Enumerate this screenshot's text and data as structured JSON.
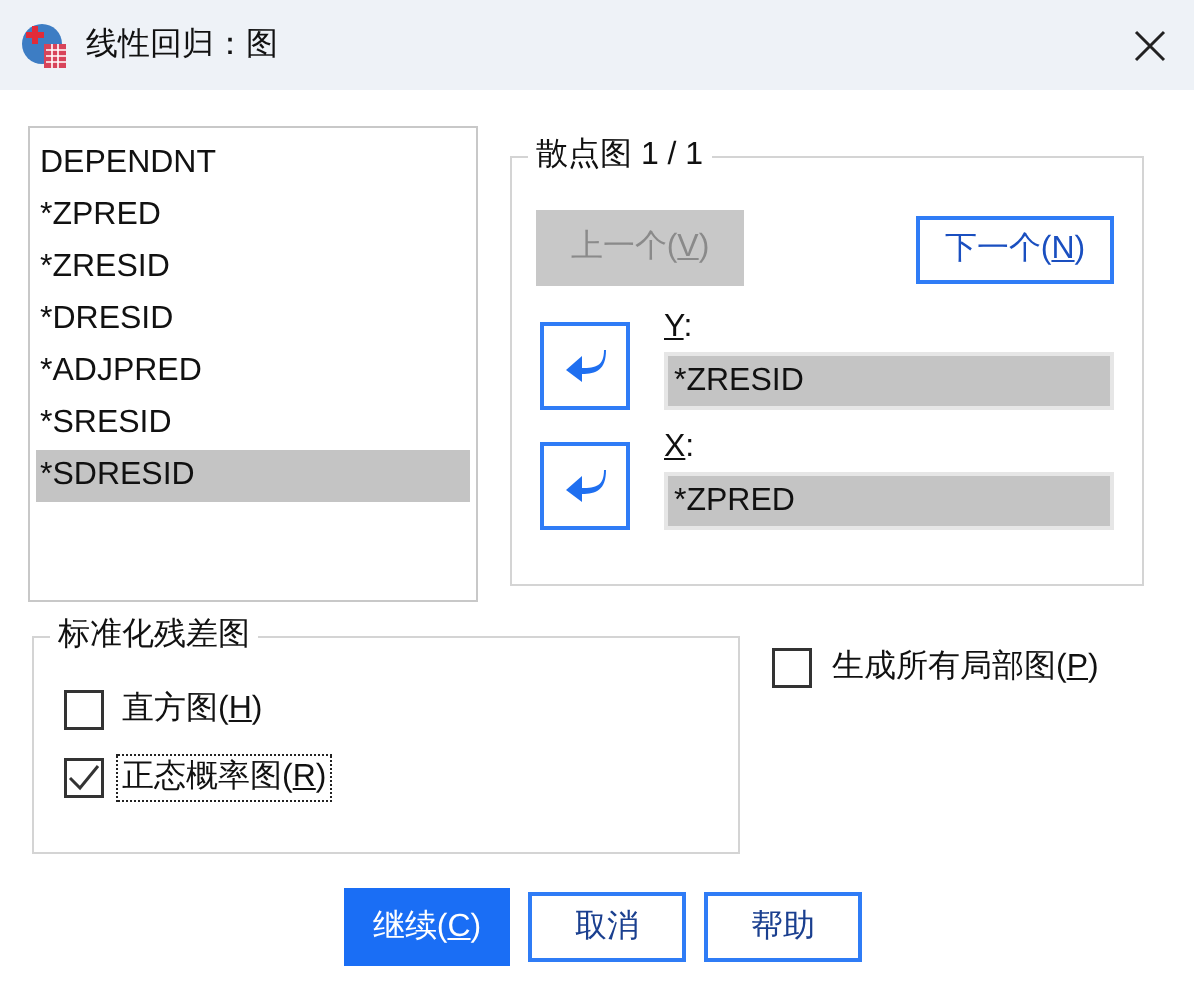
{
  "window": {
    "title": "线性回归：图"
  },
  "variables": [
    {
      "label": "DEPENDNT",
      "selected": false
    },
    {
      "label": "*ZPRED",
      "selected": false
    },
    {
      "label": "*ZRESID",
      "selected": false
    },
    {
      "label": "*DRESID",
      "selected": false
    },
    {
      "label": "*ADJPRED",
      "selected": false
    },
    {
      "label": "*SRESID",
      "selected": false
    },
    {
      "label": "*SDRESID",
      "selected": true
    }
  ],
  "scatter": {
    "legend": "散点图 1 / 1",
    "previous": {
      "label": "上一个(V)",
      "disabled": true
    },
    "next": {
      "label": "下一个(N)",
      "disabled": false
    },
    "axes": [
      {
        "label": "Y:",
        "value": "*ZRESID"
      },
      {
        "label": "X:",
        "value": "*ZPRED"
      }
    ]
  },
  "standardized_residual_plots": {
    "legend": "标准化残差图",
    "options": [
      {
        "label": "直方图(H)",
        "checked": false,
        "focused": false
      },
      {
        "label": "正态概率图(R)",
        "checked": true,
        "focused": true
      }
    ]
  },
  "produce_all_partial_plots": {
    "label": "生成所有局部图(P)",
    "checked": false
  },
  "buttons": [
    {
      "label": "继续(C)",
      "default": true
    },
    {
      "label": "取消",
      "default": false
    },
    {
      "label": "帮助",
      "default": false
    }
  ]
}
